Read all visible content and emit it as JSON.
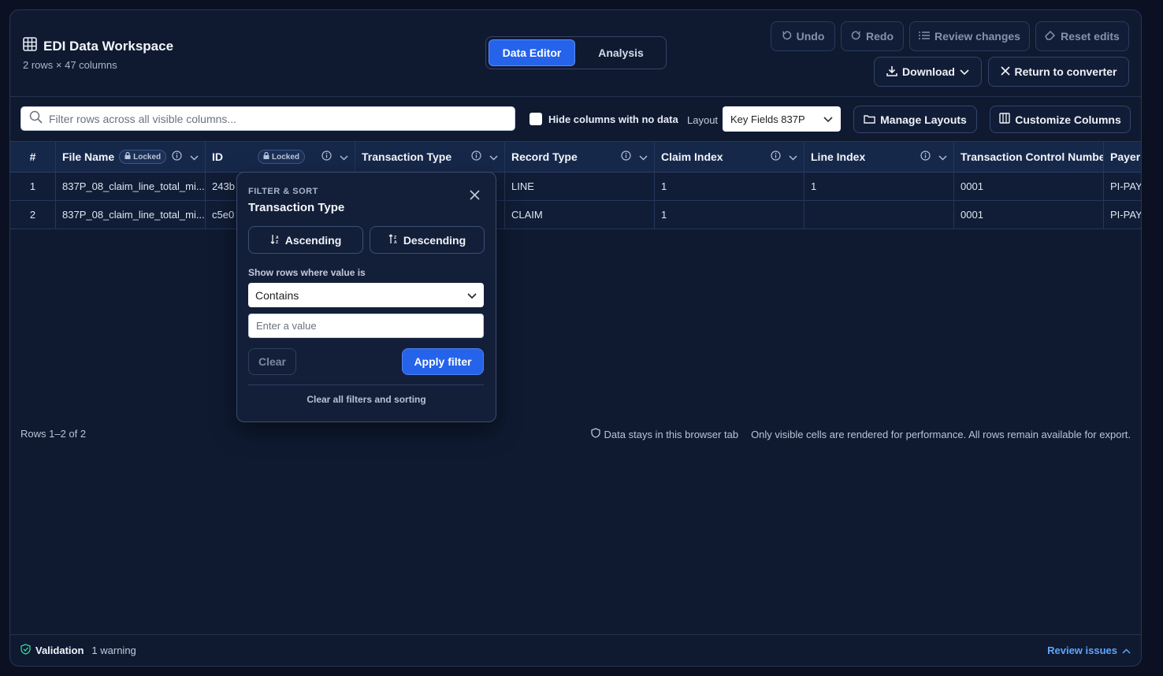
{
  "app": {
    "title": "EDI Data Workspace",
    "subtitle": "2 rows × 47 columns"
  },
  "view_tabs": [
    {
      "label": "Data Editor",
      "active": true
    },
    {
      "label": "Analysis",
      "active": false
    }
  ],
  "actions": {
    "undo": "Undo",
    "redo": "Redo",
    "review_changes": "Review changes",
    "reset_edits": "Reset edits",
    "download": "Download",
    "return": "Return to converter"
  },
  "toolbar": {
    "search_placeholder": "Filter rows across all visible columns...",
    "hide_empty_label": "Hide columns with no data",
    "layout_label": "Layout",
    "layout_value": "Key Fields 837P",
    "manage_layouts": "Manage Layouts",
    "customize_columns": "Customize Columns"
  },
  "table": {
    "locked_badge": "Locked",
    "columns": [
      "#",
      "File Name",
      "ID",
      "Transaction Type",
      "Record Type",
      "Claim Index",
      "Line Index",
      "Transaction Control Number",
      "Payer I"
    ],
    "rows": [
      [
        "1",
        "837P_08_claim_line_total_mi...",
        "243b",
        "",
        "LINE",
        "1",
        "1",
        "0001",
        "PI-PAYI"
      ],
      [
        "2",
        "837P_08_claim_line_total_mi...",
        "c5e0",
        "",
        "CLAIM",
        "1",
        "",
        "0001",
        "PI-PAYI"
      ]
    ]
  },
  "footer": {
    "rows_range": "Rows 1–2 of 2",
    "privacy": "Data stays in this browser tab",
    "note": "Only visible cells are rendered for performance. All rows remain available for export."
  },
  "status": {
    "label": "Validation",
    "warnings": "1 warning",
    "review": "Review issues"
  },
  "popover": {
    "eyebrow": "FILTER & SORT",
    "title": "Transaction Type",
    "ascending": "Ascending",
    "descending": "Descending",
    "condition_label": "Show rows where value is",
    "condition_value": "Contains",
    "value_placeholder": "Enter a value",
    "clear": "Clear",
    "apply": "Apply filter",
    "clear_all": "Clear all filters and sorting"
  },
  "colors": {
    "accent": "#2563eb",
    "link": "#60a5fa",
    "background": "#0f1a31"
  }
}
